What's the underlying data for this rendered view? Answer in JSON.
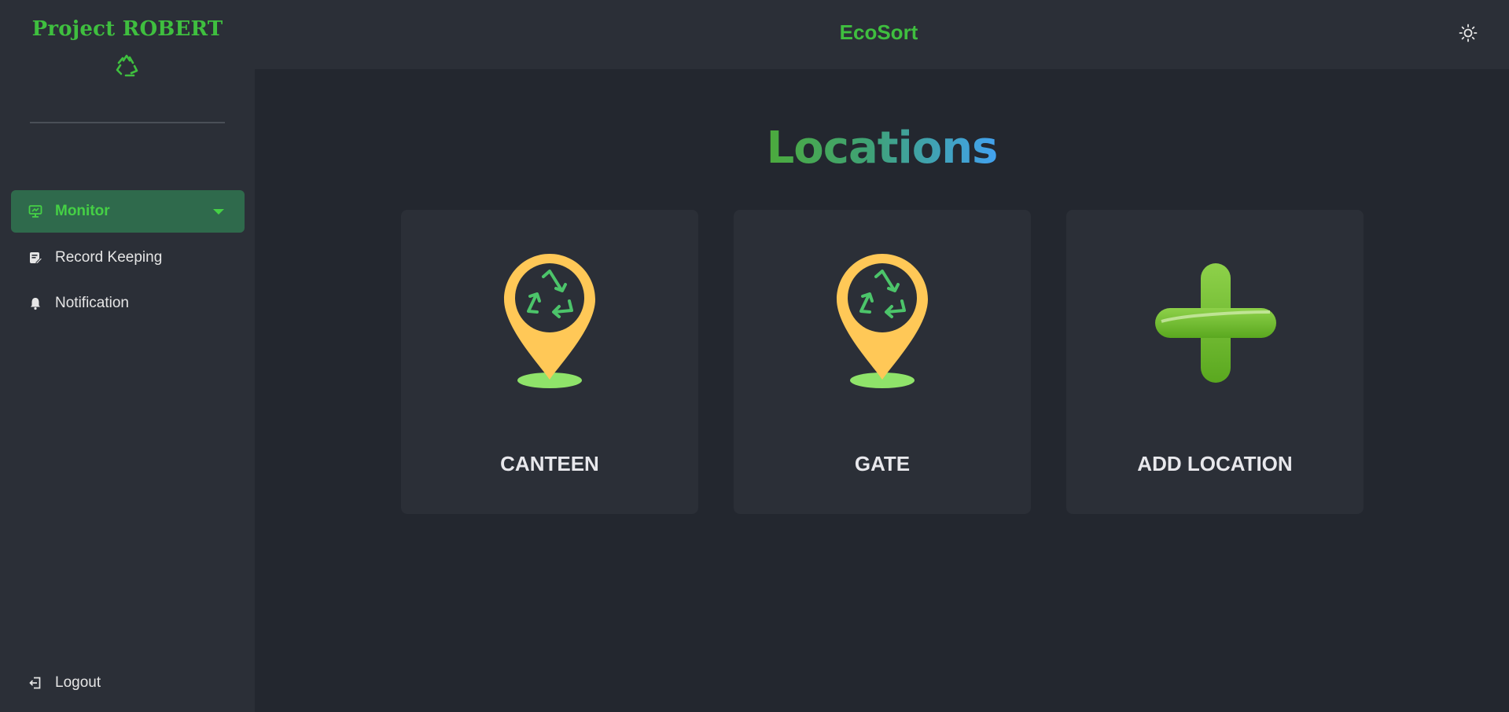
{
  "app": {
    "brand": "Project ROBERT",
    "header_title": "EcoSort"
  },
  "sidebar": {
    "items": [
      {
        "label": "Monitor",
        "icon": "monitor-icon",
        "active": true
      },
      {
        "label": "Record Keeping",
        "icon": "record-keeping-icon",
        "active": false
      },
      {
        "label": "Notification",
        "icon": "bell-icon",
        "active": false
      }
    ],
    "logout_label": "Logout"
  },
  "main": {
    "title": "Locations",
    "cards": [
      {
        "label": "CANTEEN",
        "icon": "location-pin-recycle-icon"
      },
      {
        "label": "GATE",
        "icon": "location-pin-recycle-icon"
      },
      {
        "label": "ADD LOCATION",
        "icon": "plus-icon"
      }
    ]
  },
  "colors": {
    "accent_green": "#3fbf3f",
    "active_nav_bg": "#2f6a4c",
    "pin_yellow": "#ffc857",
    "plus_green": "#6fbf2c",
    "page_bg": "#23272f",
    "panel_bg": "#2b2f37"
  }
}
